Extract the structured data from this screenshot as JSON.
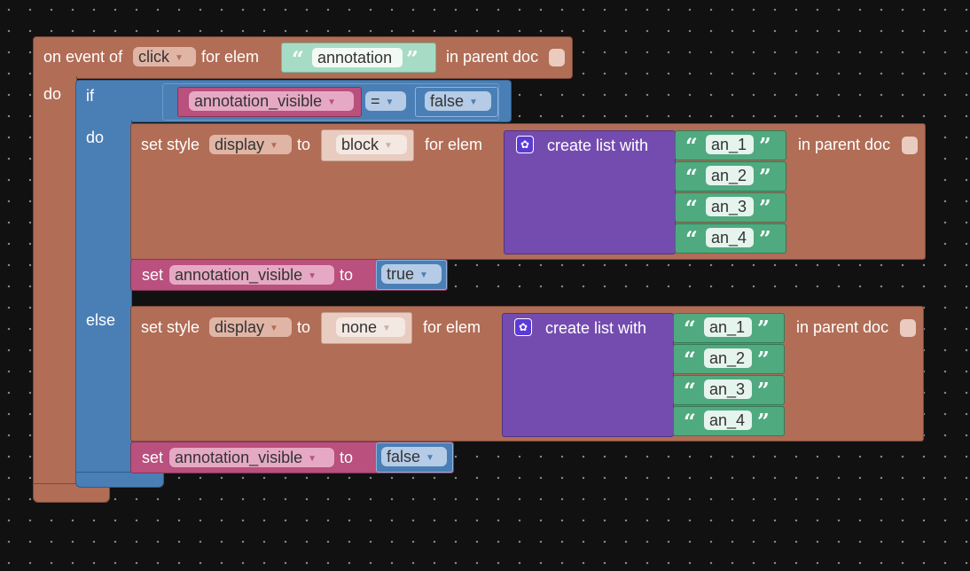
{
  "event": {
    "prefix": "on event of",
    "event_type": "click",
    "for_elem": "for elem",
    "element_id": "annotation",
    "in_parent_doc": "in parent doc",
    "do": "do"
  },
  "if_block": {
    "if": "if",
    "do": "do",
    "else": "else",
    "condition": {
      "variable": "annotation_visible",
      "operator": "=",
      "value": "false"
    }
  },
  "then_branch": {
    "style": {
      "set_style": "set style",
      "property": "display",
      "to": "to",
      "value": "block",
      "for_elem": "for elem",
      "create_list": "create list with",
      "in_parent_doc": "in parent doc",
      "items": [
        "an_1",
        "an_2",
        "an_3",
        "an_4"
      ]
    },
    "set_var": {
      "set": "set",
      "variable": "annotation_visible",
      "to": "to",
      "value": "true"
    }
  },
  "else_branch": {
    "style": {
      "set_style": "set style",
      "property": "display",
      "to": "to",
      "value": "none",
      "for_elem": "for elem",
      "create_list": "create list with",
      "in_parent_doc": "in parent doc",
      "items": [
        "an_1",
        "an_2",
        "an_3",
        "an_4"
      ]
    },
    "set_var": {
      "set": "set",
      "variable": "annotation_visible",
      "to": "to",
      "value": "false"
    }
  },
  "colors": {
    "event": "#b16d56",
    "logic": "#4a7fb5",
    "variable": "#b9507e",
    "list": "#744cb0",
    "text": "#4faa7f"
  }
}
